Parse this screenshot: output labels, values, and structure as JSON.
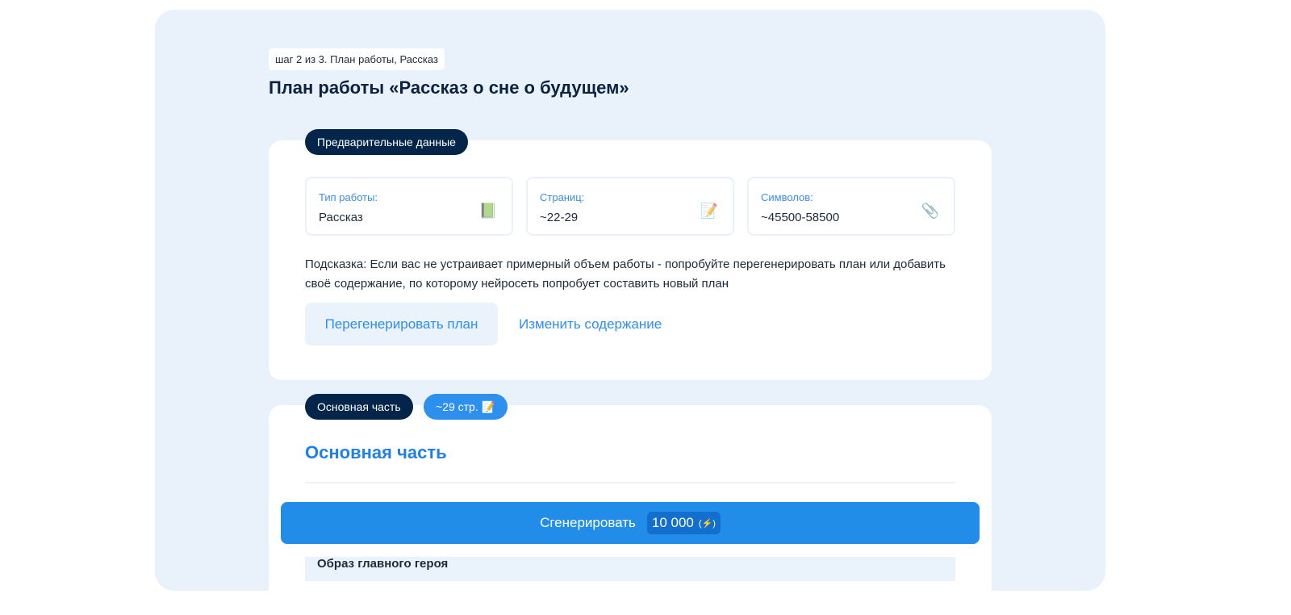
{
  "step_label": "шаг 2 из 3. План работы, Рассказ",
  "title": "План работы «Рассказ о сне о будущем»",
  "preliminary": {
    "badge": "Предварительные данные",
    "fields": [
      {
        "label": "Тип работы:",
        "value": "Рассказ",
        "icon": "📗"
      },
      {
        "label": "Страниц:",
        "value": "~22-29",
        "icon": "📝"
      },
      {
        "label": "Символов:",
        "value": "~45500-58500",
        "icon": "📎"
      }
    ],
    "hint": "Подсказка: Если вас не устраивает примерный объем работы - попробуйте перегенерировать план или добавить своё содержание, по которому нейросеть попробует составить новый план",
    "regenerate_label": "Перегенерировать план",
    "edit_label": "Изменить содержание"
  },
  "main_part": {
    "badge": "Основная часть",
    "pages_badge": "~29 стр. 📝",
    "heading": "Основная часть",
    "subheading": "Образ главного героя"
  },
  "generate": {
    "label": "Сгенерировать",
    "cost": "10 000",
    "icon": "(⚡)"
  }
}
